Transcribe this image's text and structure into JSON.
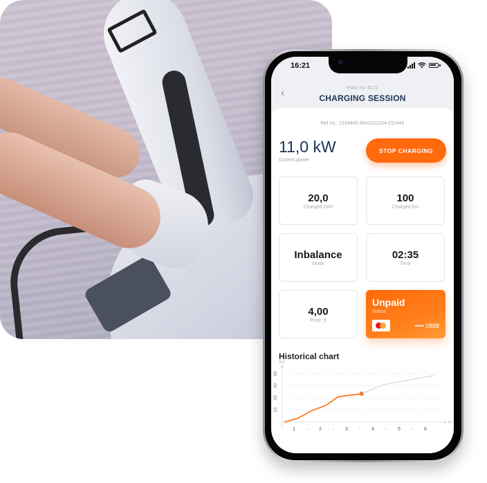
{
  "phone": {
    "status_bar": {
      "time": "16:21"
    },
    "header": {
      "point_no": "Point no: 4172",
      "title": "CHARGING SESSION",
      "back_icon": "chevron-left-icon"
    },
    "ref_no": "Ref no.: 1234445-4541231234-231444",
    "power": {
      "value": "11,0 kW",
      "label": "Current power"
    },
    "stop_button": "STOP CHARGING",
    "tiles": [
      {
        "value": "20,0",
        "label": "Charged kWh"
      },
      {
        "value": "100",
        "label": "Charged km"
      },
      {
        "value": "Inbalance",
        "label": "Mode"
      },
      {
        "value": "02:35",
        "label": "Time"
      },
      {
        "value": "4,00",
        "label": "Price, €"
      }
    ],
    "payment": {
      "value": "Unpaid",
      "label": "Status",
      "card_brand": "mastercard",
      "card_number": "•••• 0888"
    },
    "chart_title": "Historical chart"
  },
  "colors": {
    "accent": "#ff6a0d",
    "title": "#1f3556",
    "projection": "#d3d8df"
  },
  "chart_data": {
    "type": "line",
    "title": "Historical chart",
    "xlabel": "H",
    "ylabel": "Km",
    "x_ticks": [
      "1",
      "2",
      "3",
      "4",
      "5",
      "6"
    ],
    "y_ticks": [
      "10",
      "20",
      "40",
      "60"
    ],
    "xlim": [
      0,
      6
    ],
    "grid": true,
    "series": [
      {
        "name": "actual",
        "color": "#ff6a0d",
        "x": [
          0.1,
          0.6,
          1.1,
          1.7,
          2.15,
          2.9,
          3.05
        ],
        "y": [
          0,
          3,
          9,
          14,
          22,
          26,
          27
        ],
        "marker_last": true
      },
      {
        "name": "projection",
        "color": "#d3d8df",
        "x": [
          3.05,
          3.9,
          4.9,
          5.8
        ],
        "y": [
          27,
          42,
          50,
          57
        ]
      }
    ]
  }
}
